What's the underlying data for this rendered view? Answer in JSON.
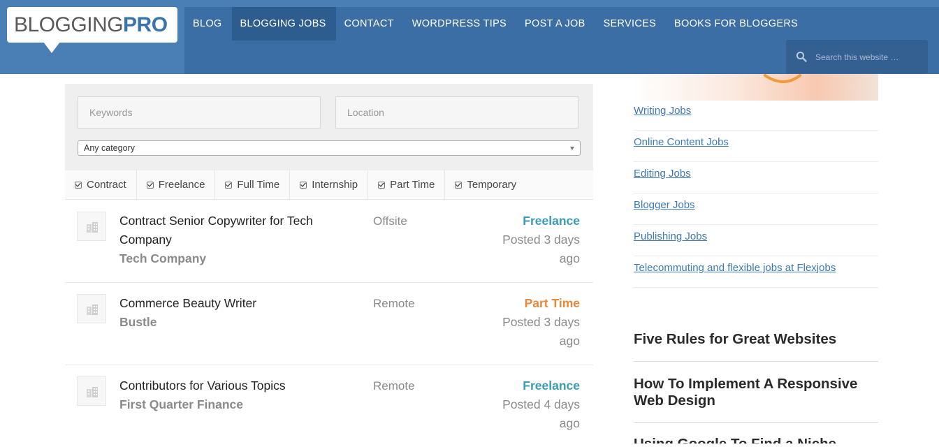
{
  "logo": {
    "part1": "BLOGGING",
    "part2": "PRO"
  },
  "nav": [
    {
      "label": "BLOG"
    },
    {
      "label": "BLOGGING JOBS"
    },
    {
      "label": "CONTACT"
    },
    {
      "label": "WORDPRESS TIPS"
    },
    {
      "label": "POST A JOB"
    },
    {
      "label": "SERVICES"
    },
    {
      "label": "BOOKS FOR BLOGGERS"
    }
  ],
  "search": {
    "placeholder": "Search this website …"
  },
  "filters": {
    "keywords_placeholder": "Keywords",
    "location_placeholder": "Location",
    "category_selected": "Any category",
    "types": [
      "Contract",
      "Freelance",
      "Full Time",
      "Internship",
      "Part Time",
      "Temporary"
    ]
  },
  "jobs": [
    {
      "title": "Contract Senior Copywriter for Tech Company",
      "company": "Tech Company",
      "location": "Offsite",
      "type": "Freelance",
      "posted": "Posted 3 days ago"
    },
    {
      "title": "Commerce Beauty Writer",
      "company": "Bustle",
      "location": "Remote",
      "type": "Part Time",
      "posted": "Posted 3 days ago"
    },
    {
      "title": "Contributors for Various Topics",
      "company": "First Quarter Finance",
      "location": "Remote",
      "type": "Freelance",
      "posted": "Posted 4 days ago"
    }
  ],
  "colors": {
    "freelance": "#3a9bb5",
    "part_time": "#e8873a",
    "header": "#4a7fb5",
    "navbar": "#3a6ea5"
  },
  "sidebar": {
    "links": [
      "Writing Jobs",
      "Online Content Jobs",
      "Editing Jobs",
      "Blogger Jobs",
      "Publishing Jobs",
      "Telecommuting and flexible jobs at Flexjobs"
    ],
    "posts": [
      "Five Rules for Great Websites",
      "How To Implement A Responsive Web Design",
      "Using Google To Find a Niche"
    ]
  }
}
